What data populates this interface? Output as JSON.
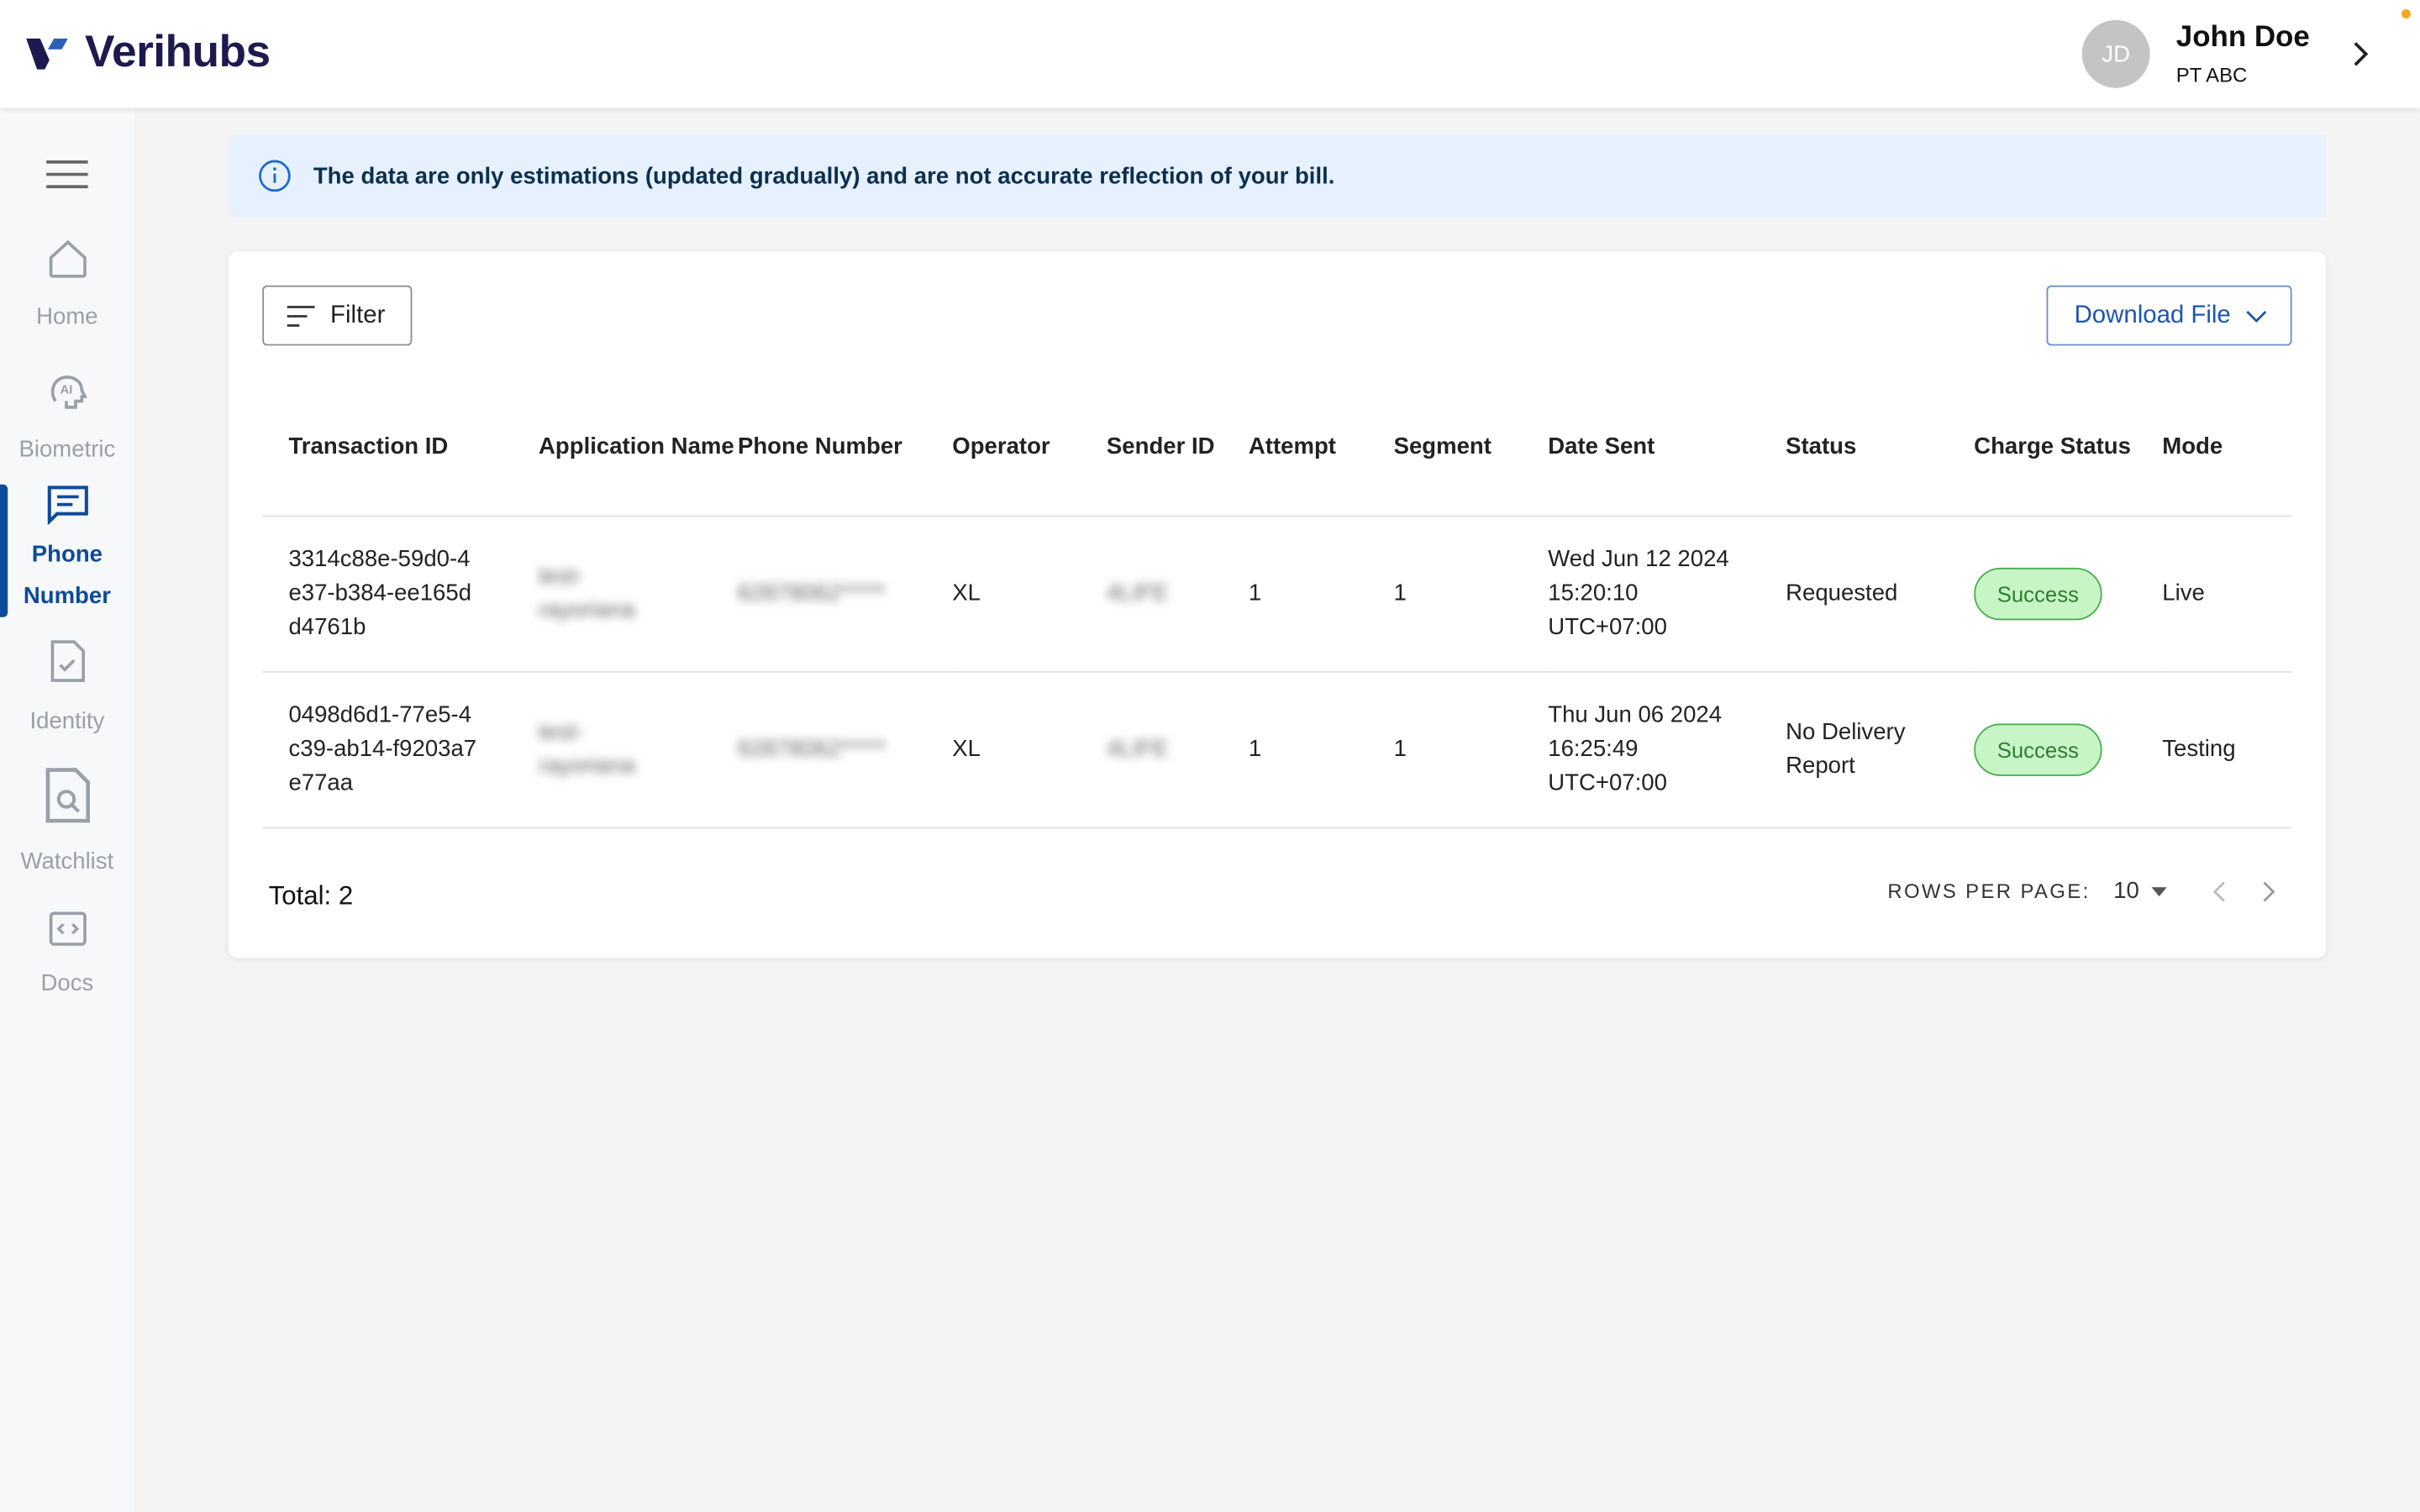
{
  "header": {
    "brand": "Verihubs",
    "user": {
      "initials": "JD",
      "name": "John Doe",
      "company": "PT ABC"
    }
  },
  "sidebar": {
    "items": [
      {
        "label": "Home",
        "icon": "home-icon"
      },
      {
        "label": "Biometric",
        "icon": "ai-head-icon"
      },
      {
        "label": "Phone Number",
        "icon": "message-icon",
        "active": true
      },
      {
        "label": "Identity",
        "icon": "document-check-icon"
      },
      {
        "label": "Watchlist",
        "icon": "document-search-icon"
      },
      {
        "label": "Docs",
        "icon": "code-icon"
      }
    ]
  },
  "banner": {
    "text": "The data are only estimations (updated gradually) and are not accurate reflection of your bill."
  },
  "toolbar": {
    "filter_label": "Filter",
    "download_label": "Download File"
  },
  "table": {
    "columns": [
      "Transaction ID",
      "Application Name",
      "Phone Number",
      "Operator",
      "Sender ID",
      "Attempt",
      "Segment",
      "Date Sent",
      "Status",
      "Charge Status",
      "Mode"
    ],
    "rows": [
      {
        "id": "3314c88e-59d0-4e37-b384-ee165dd4761b",
        "app": "test-rayoriana",
        "phone": "62878062*****",
        "operator": "XL",
        "sender": "4LIFE",
        "attempt": "1",
        "segment": "1",
        "date": "Wed Jun 12 2024 15:20:10 UTC+07:00",
        "status": "Requested",
        "charge": "Success",
        "mode": "Live"
      },
      {
        "id": "0498d6d1-77e5-4c39-ab14-f9203a7e77aa",
        "app": "test-rayoriana",
        "phone": "62878062*****",
        "operator": "XL",
        "sender": "4LIFE",
        "attempt": "1",
        "segment": "1",
        "date": "Thu Jun 06 2024 16:25:49 UTC+07:00",
        "status": "No Delivery Report",
        "charge": "Success",
        "mode": "Testing"
      }
    ]
  },
  "footer": {
    "total": "Total: 2",
    "rows_per_page_label": "ROWS PER PAGE:",
    "rows_per_page": "10"
  },
  "colors": {
    "brand": "#1c1a4e",
    "accent": "#0d4a9a",
    "success_bg": "#c8f5c5",
    "banner_bg": "#e6f1fd"
  }
}
